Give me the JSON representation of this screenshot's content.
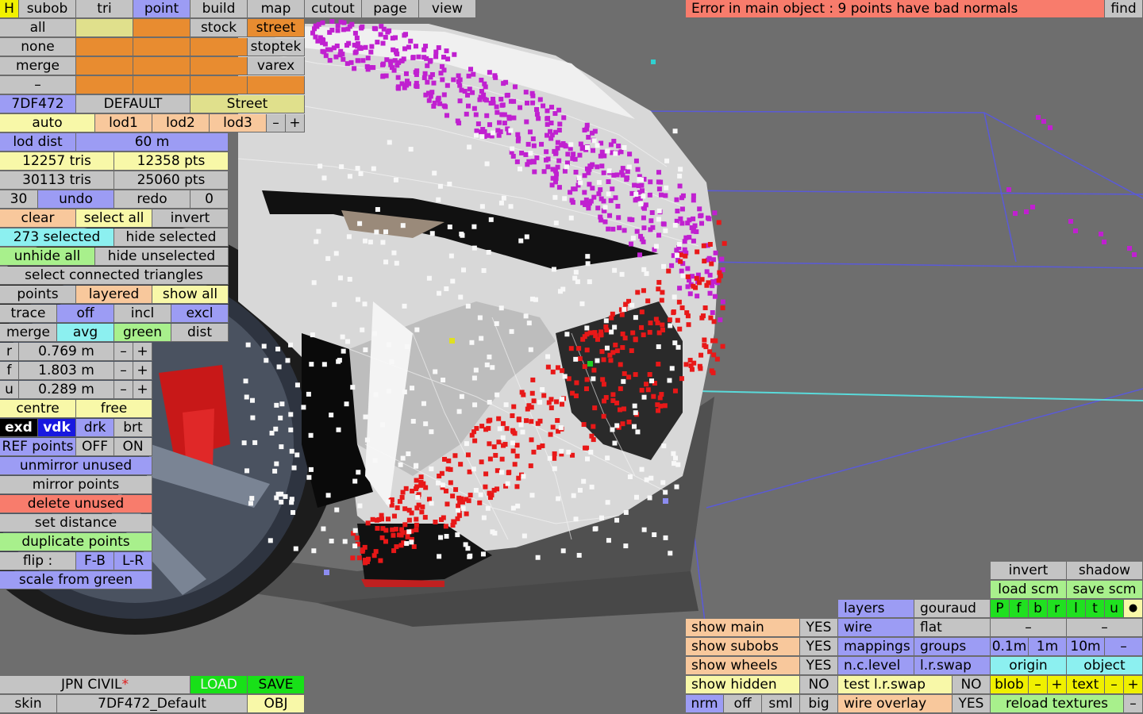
{
  "viewport": {
    "description_visible": false
  },
  "topbar": {
    "h": "H",
    "subob": "subob",
    "tri": "tri",
    "point": "point",
    "build": "build",
    "map": "map",
    "cutout": "cutout",
    "page": "page",
    "view": "view",
    "error": "Error in main object : 9 points have bad normals",
    "find": "find"
  },
  "left": {
    "all": "all",
    "none": "none",
    "merge": "merge",
    "dash": "–",
    "stock": "stock",
    "street": "street",
    "stoptek": "stoptek",
    "varex": "varex",
    "car_id": "7DF472",
    "default": "DEFAULT",
    "street_name": "Street",
    "auto": "auto",
    "lod1": "lod1",
    "lod2": "lod2",
    "lod3": "lod3",
    "minus": "–",
    "plus": "+",
    "lod_dist": "lod dist",
    "lod_val": "60 m",
    "tris1": "12257 tris",
    "pts1": "12358 pts",
    "tris2": "30113 tris",
    "pts2": "25060 pts",
    "undo_n": "30",
    "undo": "undo",
    "redo": "redo",
    "redo_n": "0",
    "clear": "clear",
    "select_all": "select all",
    "invert": "invert",
    "selected": "273 selected",
    "hide_selected": "hide selected",
    "unhide_all": "unhide all",
    "hide_unselected": "hide unselected",
    "select_connected": "select connected triangles",
    "points": "points",
    "layered": "layered",
    "show_all": "show all",
    "trace": "trace",
    "off": "off",
    "incl": "incl",
    "excl": "excl",
    "merge2": "merge",
    "avg": "avg",
    "green": "green",
    "dist": "dist",
    "r": "r",
    "r_val": "0.769 m",
    "f": "f",
    "f_val": "1.803 m",
    "u": "u",
    "u_val": "0.289 m",
    "centre": "centre",
    "free": "free",
    "exd": "exd",
    "vdk": "vdk",
    "drk": "drk",
    "brt": "brt",
    "ref_points": "REF points",
    "ref_off": "OFF",
    "ref_on": "ON",
    "unmirror": "unmirror unused",
    "mirror": "mirror points",
    "delete_unused": "delete unused",
    "set_distance": "set distance",
    "duplicate": "duplicate points",
    "flip": "flip :",
    "fb": "F-B",
    "lr": "L-R",
    "scale_green": "scale from green"
  },
  "bottom_left": {
    "jpn": "JPN CIVIL",
    "star": "*",
    "load": "LOAD",
    "save": "SAVE",
    "skin": "skin",
    "skin_name": "7DF472_Default",
    "obj": "OBJ"
  },
  "bottom_right": {
    "show_main": "show main",
    "show_subobs": "show subobs",
    "show_wheels": "show wheels",
    "show_hidden": "show hidden",
    "yes1": "YES",
    "yes2": "YES",
    "yes3": "YES",
    "no1": "NO",
    "nrm": "nrm",
    "off": "off",
    "sml": "sml",
    "big": "big",
    "layers": "layers",
    "gouraud": "gouraud",
    "wire": "wire",
    "flat": "flat",
    "mappings": "mappings",
    "groups": "groups",
    "nclevel": "n.c.level",
    "lrswap": "l.r.swap",
    "test_swap": "test l.r.swap",
    "no2": "NO",
    "wire_overlay": "wire overlay",
    "yes4": "YES",
    "invert": "invert",
    "shadow": "shadow",
    "load_scm": "load scm",
    "save_scm": "save scm",
    "p": "P",
    "fch": "f",
    "bch": "b",
    "rch": "r",
    "lch": "l",
    "tch": "t",
    "uch": "u",
    "dot": "●",
    "dash1": "–",
    "dash2": "–",
    "m01": "0.1m",
    "m1": "1m",
    "m10": "10m",
    "mminus": "–",
    "origin": "origin",
    "object": "object",
    "blob": "blob",
    "bminus": "–",
    "bplus": "+",
    "text": "text",
    "tminus": "–",
    "tplus": "+",
    "reload": "reload textures",
    "rminus": "–"
  }
}
